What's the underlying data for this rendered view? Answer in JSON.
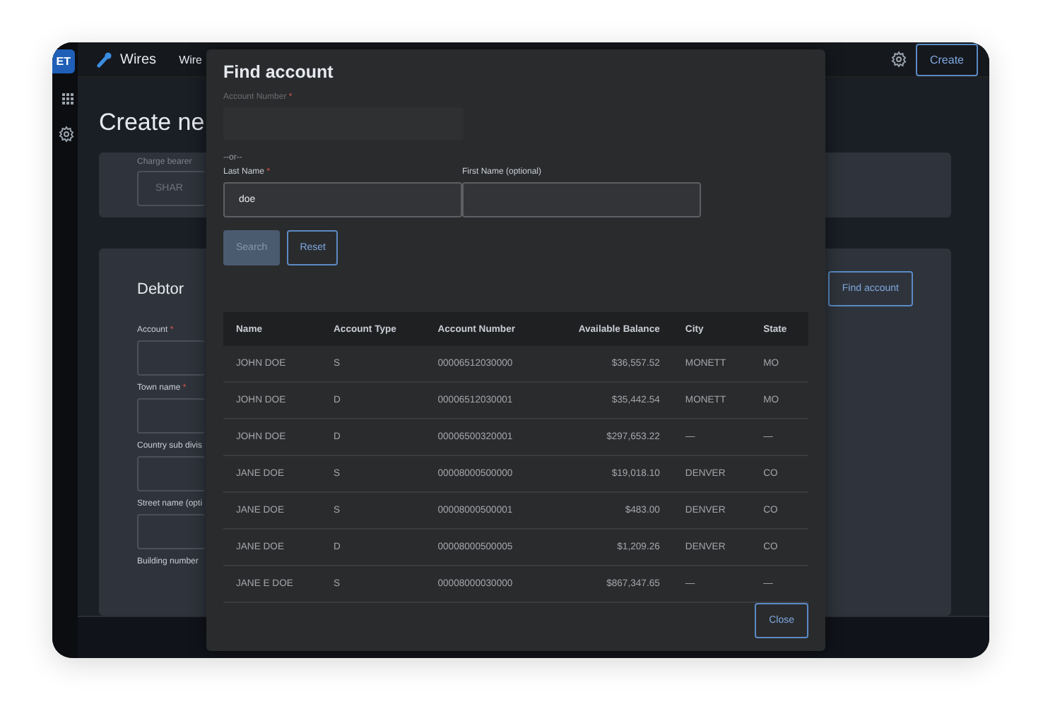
{
  "rail": {
    "badge": "ET"
  },
  "topbar": {
    "app_name": "Wires",
    "nav_item": "Wire",
    "create_button": "Create"
  },
  "page": {
    "title": "Create ne",
    "charge_bearer": {
      "label": "Charge bearer",
      "value": "SHAR"
    },
    "debtor": {
      "title": "Debtor",
      "find_account_button": "Find account",
      "fields": [
        {
          "label": "Account",
          "mark": "*"
        },
        {
          "label": "Town name",
          "mark": "*"
        },
        {
          "label": "Country sub divis"
        },
        {
          "label": "Street name (opti"
        },
        {
          "label": "Building number"
        }
      ]
    }
  },
  "dialog": {
    "title": "Find account",
    "account_number": {
      "label": "Account Number",
      "mark": "*"
    },
    "separator": "--or--",
    "last_name": {
      "label": "Last Name",
      "mark": "*",
      "value": "doe"
    },
    "first_name": {
      "label": "First Name (optional)"
    },
    "buttons": [
      {
        "kind": "primary",
        "label": "Search",
        "disabled": true
      },
      {
        "kind": "outline",
        "label": "Reset",
        "disabled": false
      }
    ],
    "table": {
      "columns": [
        "Name",
        "Account Type",
        "Account Number",
        "Available Balance",
        "City",
        "State"
      ],
      "rows": [
        [
          "JOHN DOE",
          "S",
          "00006512030000",
          "$36,557.52",
          "MONETT",
          "MO"
        ],
        [
          "JOHN DOE",
          "D",
          "00006512030001",
          "$35,442.54",
          "MONETT",
          "MO"
        ],
        [
          "JOHN DOE",
          "D",
          "00006500320001",
          "$297,653.22",
          "—",
          "—"
        ],
        [
          "JANE DOE",
          "S",
          "00008000500000",
          "$19,018.10",
          "DENVER",
          "CO"
        ],
        [
          "JANE DOE",
          "S",
          "00008000500001",
          "$483.00",
          "DENVER",
          "CO"
        ],
        [
          "JANE DOE",
          "D",
          "00008000500005",
          "$1,209.26",
          "DENVER",
          "CO"
        ],
        [
          "JANE E DOE",
          "S",
          "00008000030000",
          "$867,347.65",
          "—",
          "—"
        ]
      ]
    },
    "close_button": "Close"
  }
}
